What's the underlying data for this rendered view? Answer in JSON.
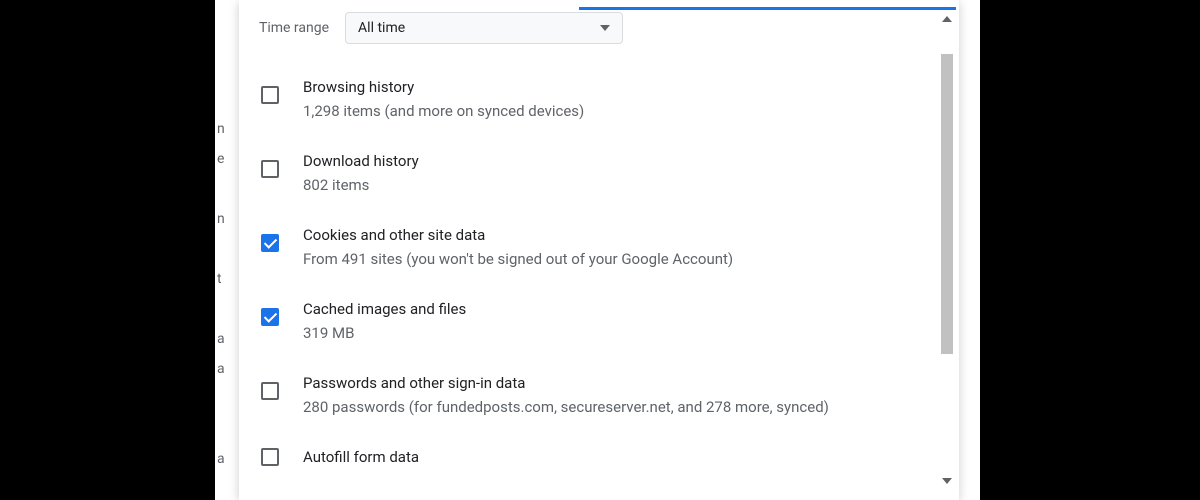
{
  "timeRange": {
    "label": "Time range",
    "value": "All time"
  },
  "items": [
    {
      "checked": false,
      "title": "Browsing history",
      "desc": "1,298 items (and more on synced devices)"
    },
    {
      "checked": false,
      "title": "Download history",
      "desc": "802 items"
    },
    {
      "checked": true,
      "title": "Cookies and other site data",
      "desc": "From 491 sites (you won't be signed out of your Google Account)"
    },
    {
      "checked": true,
      "title": "Cached images and files",
      "desc": "319 MB"
    },
    {
      "checked": false,
      "title": "Passwords and other sign-in data",
      "desc": "280 passwords (for fundedposts.com, secureserver.net, and 278 more, synced)"
    },
    {
      "checked": false,
      "title": "Autofill form data",
      "desc": ""
    }
  ]
}
